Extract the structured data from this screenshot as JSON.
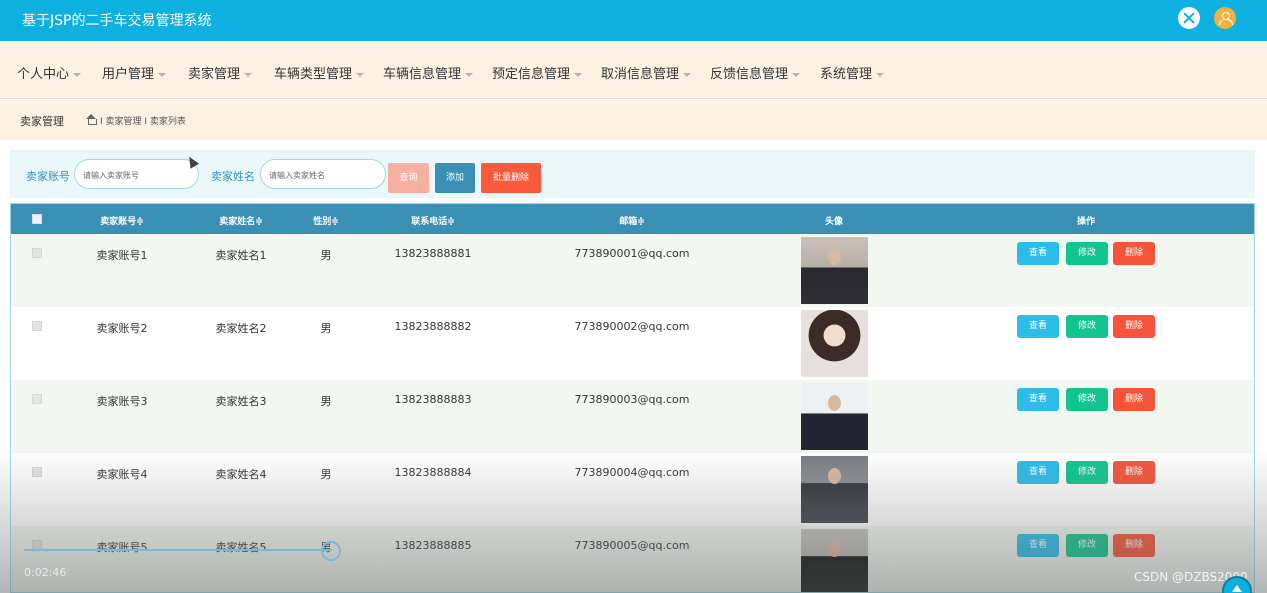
{
  "app": {
    "title": "基于JSP的二手车交易管理系统"
  },
  "nav": {
    "items": [
      {
        "label": "个人中心"
      },
      {
        "label": "用户管理"
      },
      {
        "label": "卖家管理"
      },
      {
        "label": "车辆类型管理"
      },
      {
        "label": "车辆信息管理"
      },
      {
        "label": "预定信息管理"
      },
      {
        "label": "取消信息管理"
      },
      {
        "label": "反馈信息管理"
      },
      {
        "label": "系统管理"
      }
    ]
  },
  "breadcrumb": {
    "title": "卖家管理",
    "path": "I 卖家管理 I 卖家列表"
  },
  "search": {
    "account_label": "卖家账号",
    "account_placeholder": "请输入卖家账号",
    "name_label": "卖家姓名",
    "name_placeholder": "请输入卖家姓名",
    "query_label": "查询",
    "add_label": "添加",
    "batch_delete_label": "批量删除"
  },
  "table": {
    "headers": [
      "卖家账号≑",
      "卖家姓名≑",
      "性别≑",
      "联系电话≑",
      "邮箱≑",
      "头像",
      "操作"
    ],
    "rows": [
      {
        "account": "卖家账号1",
        "name": "卖家姓名1",
        "gender": "男",
        "phone": "13823888881",
        "email": "773890001@qq.com"
      },
      {
        "account": "卖家账号2",
        "name": "卖家姓名2",
        "gender": "男",
        "phone": "13823888882",
        "email": "773890002@qq.com"
      },
      {
        "account": "卖家账号3",
        "name": "卖家姓名3",
        "gender": "男",
        "phone": "13823888883",
        "email": "773890003@qq.com"
      },
      {
        "account": "卖家账号4",
        "name": "卖家姓名4",
        "gender": "男",
        "phone": "13823888884",
        "email": "773890004@qq.com"
      },
      {
        "account": "卖家账号5",
        "name": "卖家姓名5",
        "gender": "男",
        "phone": "13823888885",
        "email": "773890005@qq.com"
      }
    ],
    "actions": {
      "view": "查看",
      "edit": "修改",
      "delete": "删除"
    }
  },
  "player": {
    "time": "0:02:46"
  },
  "watermark": "CSDN @DZBS2000",
  "icons": {
    "fullscreen": "fullscreen-icon",
    "user": "user-avatar-icon",
    "home": "home-icon",
    "caret": "caret-down-icon",
    "back_to_top": "arrow-up-icon"
  },
  "colors": {
    "topbar": "#0db0de",
    "nav_bg": "#fdf1e2",
    "table_header": "#3a8fb5",
    "view": "#2dbce8",
    "edit": "#12c58f",
    "delete": "#f5543a"
  }
}
